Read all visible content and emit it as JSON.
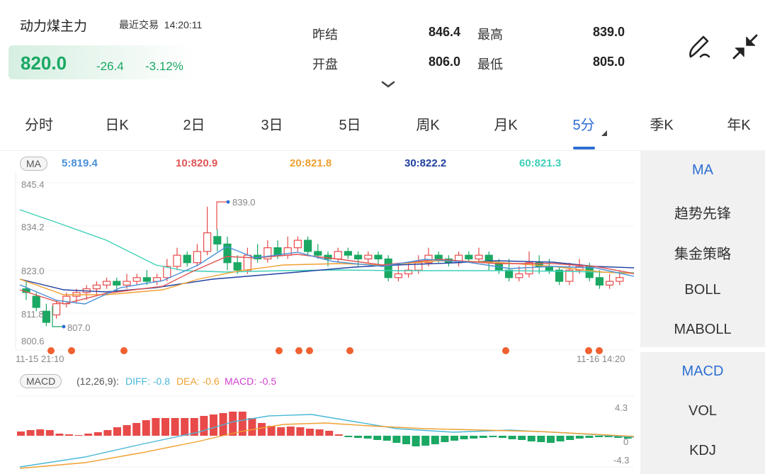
{
  "header": {
    "title": "动力煤主力",
    "last_trade_label": "最近交易",
    "last_trade_time": "14:20:11",
    "price": "820.0",
    "change": "-26.4",
    "change_pct": "-3.12%"
  },
  "quote": {
    "prev_settle_label": "昨结",
    "prev_settle": "846.4",
    "open_label": "开盘",
    "open": "806.0",
    "high_label": "最高",
    "high": "839.0",
    "low_label": "最低",
    "low": "805.0"
  },
  "icons": {
    "draw": "pen-draw-icon",
    "collapse": "collapse-arrows-icon",
    "expand": "chevron-down-icon"
  },
  "tabs": [
    {
      "label": "分时"
    },
    {
      "label": "日K"
    },
    {
      "label": "2日"
    },
    {
      "label": "3日"
    },
    {
      "label": "5日"
    },
    {
      "label": "周K"
    },
    {
      "label": "月K"
    },
    {
      "label": "5分",
      "active": true
    },
    {
      "label": "季K"
    },
    {
      "label": "年K"
    }
  ],
  "ma": {
    "badge": "MA",
    "values": [
      {
        "text": "5:819.4",
        "color": "#4a90d9"
      },
      {
        "text": "10:820.9",
        "color": "#e05555"
      },
      {
        "text": "20:821.8",
        "color": "#f0a030"
      },
      {
        "text": "30:822.2",
        "color": "#1f3fa0"
      },
      {
        "text": "60:821.3",
        "color": "#3fd0b8"
      }
    ]
  },
  "price_axis": {
    "top": "845.4",
    "l2": "834.2",
    "l3": "823.0",
    "l4": "811.8",
    "bottom": "800.6"
  },
  "annotations": {
    "high": "839.0",
    "low": "807.0"
  },
  "time_axis": {
    "start": "11-15 21:10",
    "end": "11-16 14:20"
  },
  "macd": {
    "badge": "MACD",
    "params": "(12,26,9):",
    "diff": "DIFF: -0.8",
    "dea": "DEA: -0.6",
    "macd": "MACD: -0.5",
    "diff_color": "#4ab8d8",
    "dea_color": "#f0a030",
    "macd_color": "#d040d0",
    "axis_top": "4.3",
    "axis_mid": "0",
    "axis_bottom": "-4.3"
  },
  "side_top": [
    {
      "label": "MA",
      "active": true
    },
    {
      "label": "趋势先锋"
    },
    {
      "label": "集金策略"
    },
    {
      "label": "BOLL"
    },
    {
      "label": "MABOLL"
    }
  ],
  "side_bottom": [
    {
      "label": "MACD",
      "active": true
    },
    {
      "label": "VOL"
    },
    {
      "label": "KDJ"
    }
  ],
  "colors": {
    "up": "#e84a4a",
    "down": "#1aa863",
    "accent": "#2d6fd3",
    "signal_dot": "#f06030"
  }
}
